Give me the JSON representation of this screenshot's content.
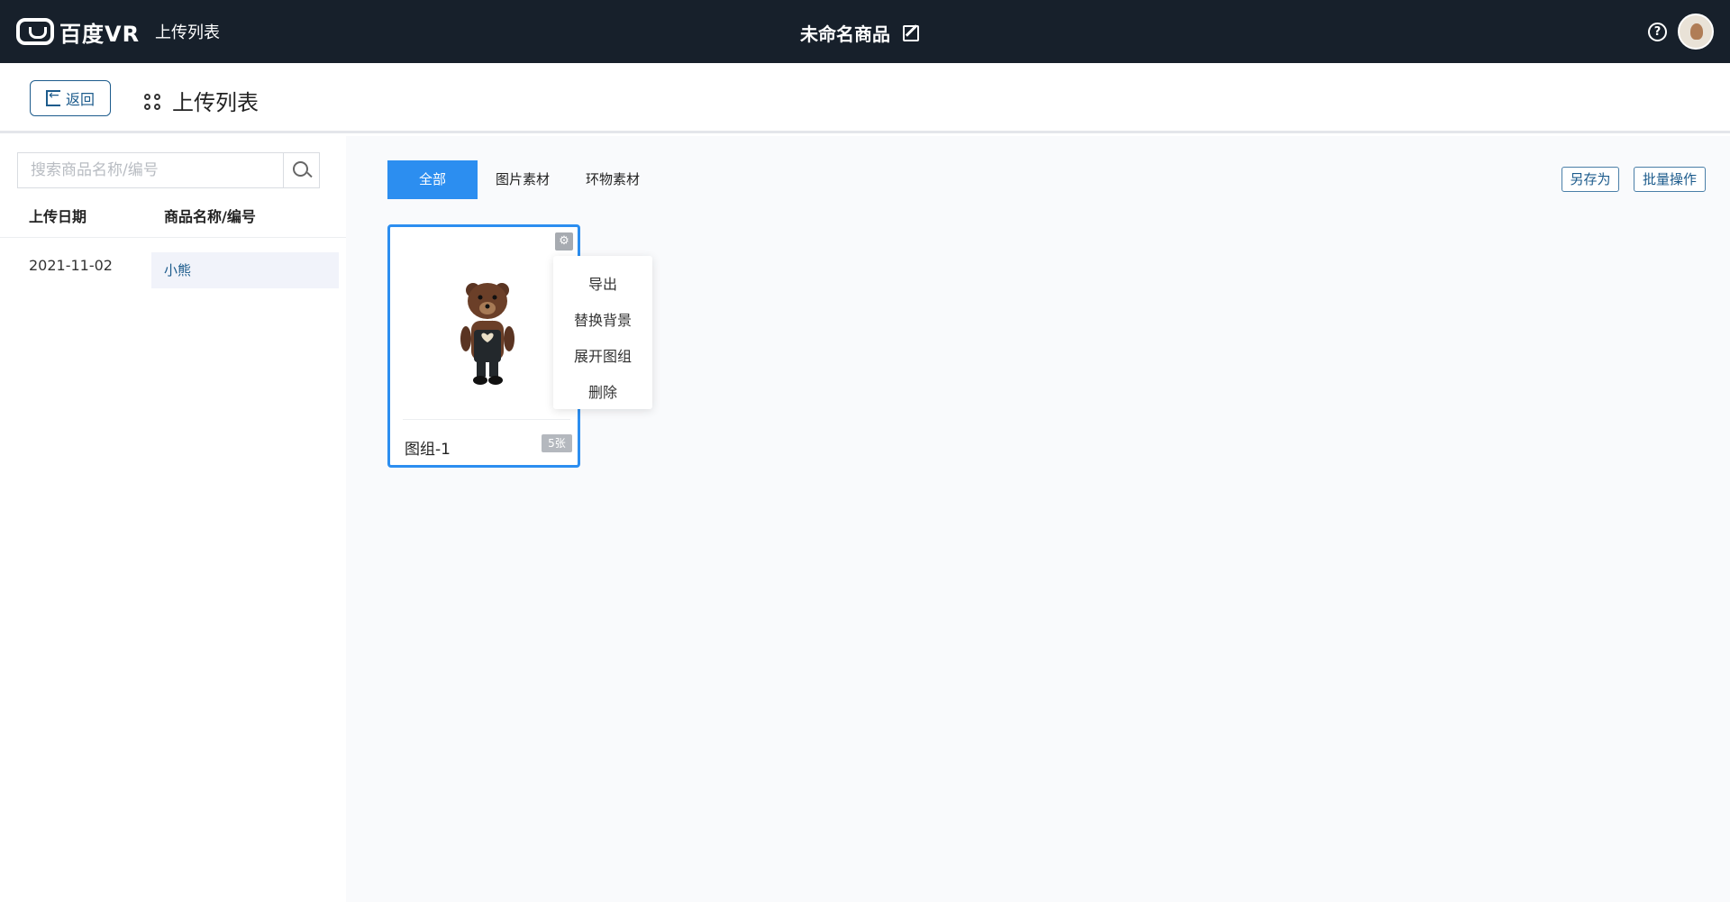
{
  "header": {
    "logo_text": "百度VR",
    "section_title": "上传列表",
    "product_title": "未命名商品"
  },
  "subheader": {
    "back_label": "返回",
    "title": "上传列表"
  },
  "left": {
    "search_placeholder": "搜索商品名称/编号",
    "columns": [
      "上传日期",
      "商品名称/编号"
    ],
    "rows": [
      {
        "date": "2021-11-02",
        "name": "小熊"
      }
    ]
  },
  "main": {
    "tabs": [
      "全部",
      "图片素材",
      "环物素材"
    ],
    "active_tab": 0,
    "actions": {
      "save_as": "另存为",
      "batch": "批量操作"
    },
    "card": {
      "label": "图组-1",
      "count": "5张"
    },
    "context_menu": [
      "导出",
      "替换背景",
      "展开图组",
      "删除"
    ]
  },
  "colors": {
    "topbar": "#17202b",
    "accent": "#2c8ef0",
    "link": "#1c5b8c"
  }
}
